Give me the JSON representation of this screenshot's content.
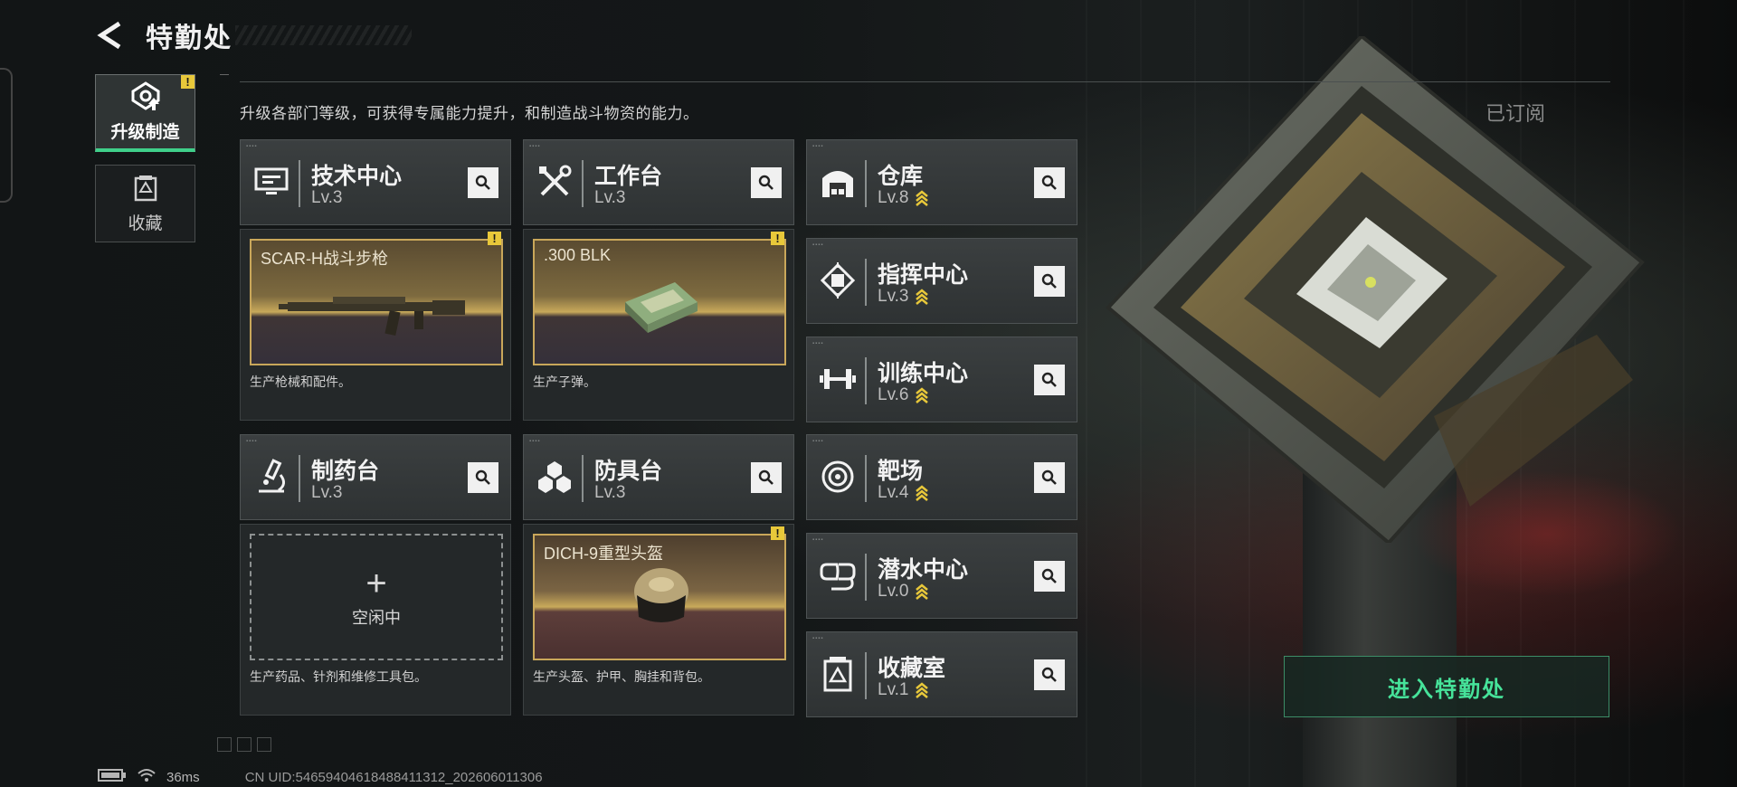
{
  "header": {
    "title": "特勤处"
  },
  "side_nav": [
    {
      "label": "升级制造",
      "active": true,
      "warning": "!"
    },
    {
      "label": "收藏",
      "active": false
    }
  ],
  "description": "升级各部门等级，可获得专属能力提升，和制造战斗物资的能力。",
  "subscribed_label": "已订阅",
  "left_departments": [
    {
      "name": "技术中心",
      "level": "Lv.3",
      "icon": "computer-icon",
      "production": {
        "item": "SCAR-H战斗步枪",
        "warning": "!",
        "desc": "生产枪械和配件。"
      }
    },
    {
      "name": "工作台",
      "level": "Lv.3",
      "icon": "tools-icon",
      "production": {
        "item": ".300 BLK",
        "warning": "!",
        "desc": "生产子弹。"
      }
    },
    {
      "name": "制药台",
      "level": "Lv.3",
      "icon": "microscope-icon",
      "production": {
        "idle": "空闲中",
        "desc": "生产药品、针剂和维修工具包。"
      }
    },
    {
      "name": "防具台",
      "level": "Lv.3",
      "icon": "armor-cubes-icon",
      "production": {
        "item": "DICH-9重型头盔",
        "warning": "!",
        "desc": "生产头盔、护甲、胸挂和背包。"
      }
    }
  ],
  "right_departments": [
    {
      "name": "仓库",
      "level": "Lv.8",
      "icon": "warehouse-icon"
    },
    {
      "name": "指挥中心",
      "level": "Lv.3",
      "icon": "chip-icon"
    },
    {
      "name": "训练中心",
      "level": "Lv.6",
      "icon": "dumbbell-icon"
    },
    {
      "name": "靶场",
      "level": "Lv.4",
      "icon": "target-icon"
    },
    {
      "name": "潜水中心",
      "level": "Lv.0",
      "icon": "diving-mask-icon"
    },
    {
      "name": "收藏室",
      "level": "Lv.1",
      "icon": "collection-icon"
    }
  ],
  "enter_button": "进入特勤处",
  "status_bar": {
    "ping": "36ms",
    "uid": "CN UID:54659404618488411312_202606011306"
  },
  "colors": {
    "accent_green": "#46e39a",
    "gold": "#c9a75a",
    "warning": "#e8c83a"
  }
}
